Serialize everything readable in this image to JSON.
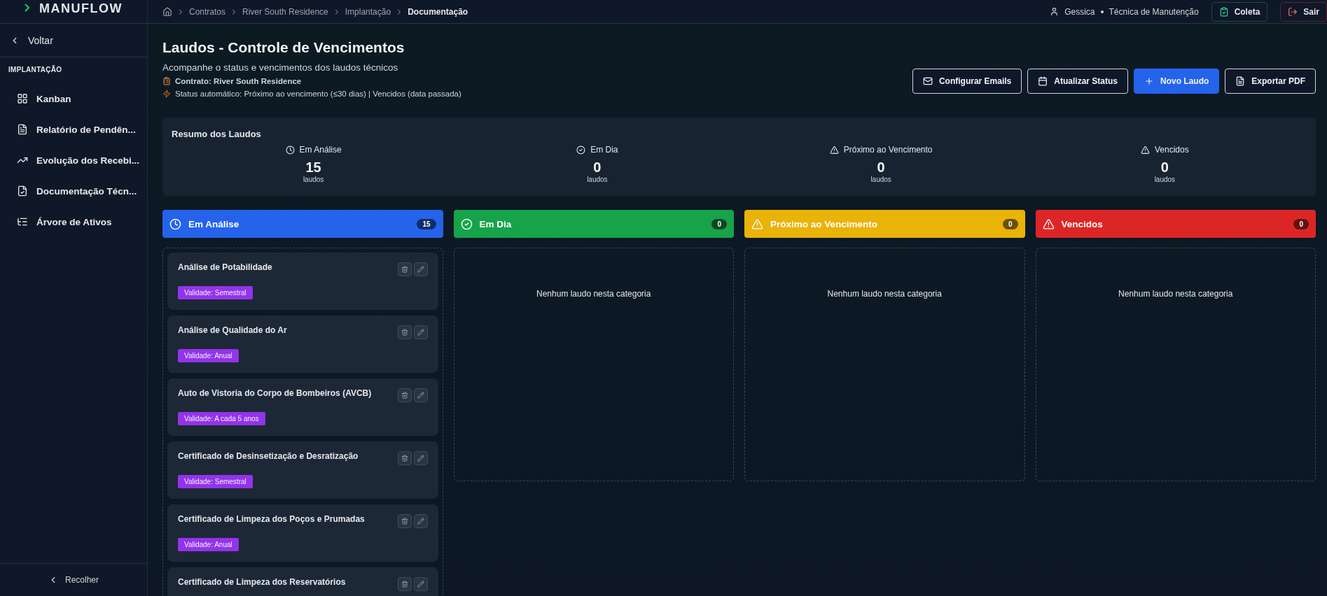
{
  "sidebar": {
    "logo": "MANUFLOW",
    "back": "Voltar",
    "section": "IMPLANTAÇÃO",
    "items": [
      {
        "label": "Kanban",
        "kind": "grid"
      },
      {
        "label": "Relatório de Pendên...",
        "kind": "doc"
      },
      {
        "label": "Evolução dos Recebi...",
        "kind": "trend"
      },
      {
        "label": "Documentação Técn...",
        "kind": "doccheck"
      },
      {
        "label": "Árvore de Ativos",
        "kind": "tree"
      }
    ],
    "collapse": "Recolher"
  },
  "breadcrumb": [
    "Contratos",
    "River South Residence",
    "Implantação",
    "Documentação"
  ],
  "user": {
    "name": "Gessica",
    "role": "Técnica de Manutenção"
  },
  "top_buttons": [
    {
      "label": "Coleta",
      "kind": "collect"
    },
    {
      "label": "Sair",
      "kind": "logout"
    }
  ],
  "page": {
    "title": "Laudos - Controle de Vencimentos",
    "subtitle": "Acompanhe o status e vencimentos dos laudos técnicos",
    "contract": "Contrato: River South Residence",
    "status_note": "Status automático: Próximo ao vencimento (≤30 dias) | Vencidos (data passada)"
  },
  "actions": [
    {
      "label": "Configurar Emails",
      "kind": "mail",
      "primary": false
    },
    {
      "label": "Atualizar Status",
      "kind": "calendar",
      "primary": false
    },
    {
      "label": "Novo Laudo",
      "kind": "plus",
      "primary": true
    },
    {
      "label": "Exportar PDF",
      "kind": "file",
      "primary": false
    }
  ],
  "summary": {
    "title": "Resumo dos Laudos",
    "items": [
      {
        "label": "Em Análise",
        "count": "15",
        "unit": "laudos",
        "kind": "analysis"
      },
      {
        "label": "Em Dia",
        "count": "0",
        "unit": "laudos",
        "kind": "ok"
      },
      {
        "label": "Próximo ao Vencimento",
        "count": "0",
        "unit": "laudos",
        "kind": "warning"
      },
      {
        "label": "Vencidos",
        "count": "0",
        "unit": "laudos",
        "kind": "expired"
      }
    ]
  },
  "columns": [
    {
      "title": "Em Análise",
      "count": "15",
      "kind": "analysis",
      "color": "#2563eb",
      "cards": [
        {
          "title": "Análise de Potabilidade",
          "badge": "Validade: Semestral"
        },
        {
          "title": "Análise de Qualidade do Ar",
          "badge": "Validade: Anual"
        },
        {
          "title": "Auto de Vistoria do Corpo de Bombeiros (AVCB)",
          "badge": "Validade: A cada 5 anos"
        },
        {
          "title": "Certificado de Desinsetização e Desratização",
          "badge": "Validade: Semestral"
        },
        {
          "title": "Certificado de Limpeza dos Poços e Prumadas",
          "badge": "Validade: Anual"
        },
        {
          "title": "Certificado de Limpeza dos Reservatórios"
        }
      ]
    },
    {
      "title": "Em Dia",
      "count": "0",
      "kind": "ok",
      "color": "#16a34a",
      "empty": "Nenhum laudo nesta categoria"
    },
    {
      "title": "Próximo ao Vencimento",
      "count": "0",
      "kind": "warning",
      "color": "#eab308",
      "empty": "Nenhum laudo nesta categoria"
    },
    {
      "title": "Vencidos",
      "count": "0",
      "kind": "expired",
      "color": "#dc2626",
      "empty": "Nenhum laudo nesta categoria"
    }
  ]
}
